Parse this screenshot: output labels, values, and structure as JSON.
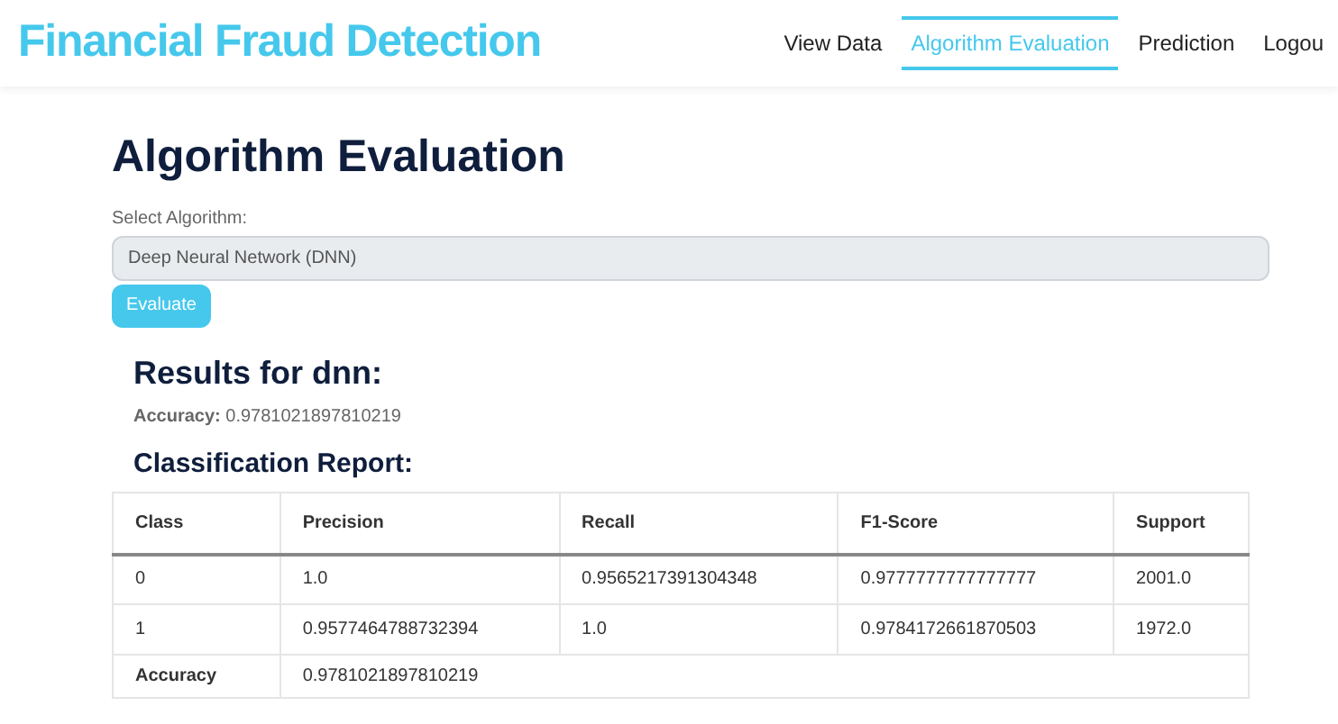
{
  "header": {
    "title": "Financial Fraud Detection",
    "nav": [
      {
        "label": "View Data",
        "selected": false
      },
      {
        "label": "Algorithm Evaluation",
        "selected": true
      },
      {
        "label": "Prediction",
        "selected": false
      },
      {
        "label": "Logou",
        "selected": false
      }
    ]
  },
  "page_title": "Algorithm Evaluation",
  "form": {
    "label": "Select Algorithm:",
    "select_value": "Deep Neural Network (DNN)",
    "button": "Evaluate"
  },
  "results": {
    "title": "Results for dnn:",
    "accuracy_label": "Accuracy:",
    "accuracy_value": "0.9781021897810219",
    "report_title": "Classification Report:"
  },
  "table": {
    "columns": [
      "Class",
      "Precision",
      "Recall",
      "F1-Score",
      "Support"
    ],
    "rows": [
      [
        "0",
        "1.0",
        "0.9565217391304348",
        "0.9777777777777777",
        "2001.0"
      ],
      [
        "1",
        "0.9577464788732394",
        "1.0",
        "0.9784172661870503",
        "1972.0"
      ]
    ],
    "accuracy_row": {
      "label": "Accuracy",
      "value": "0.9781021897810219"
    }
  }
}
